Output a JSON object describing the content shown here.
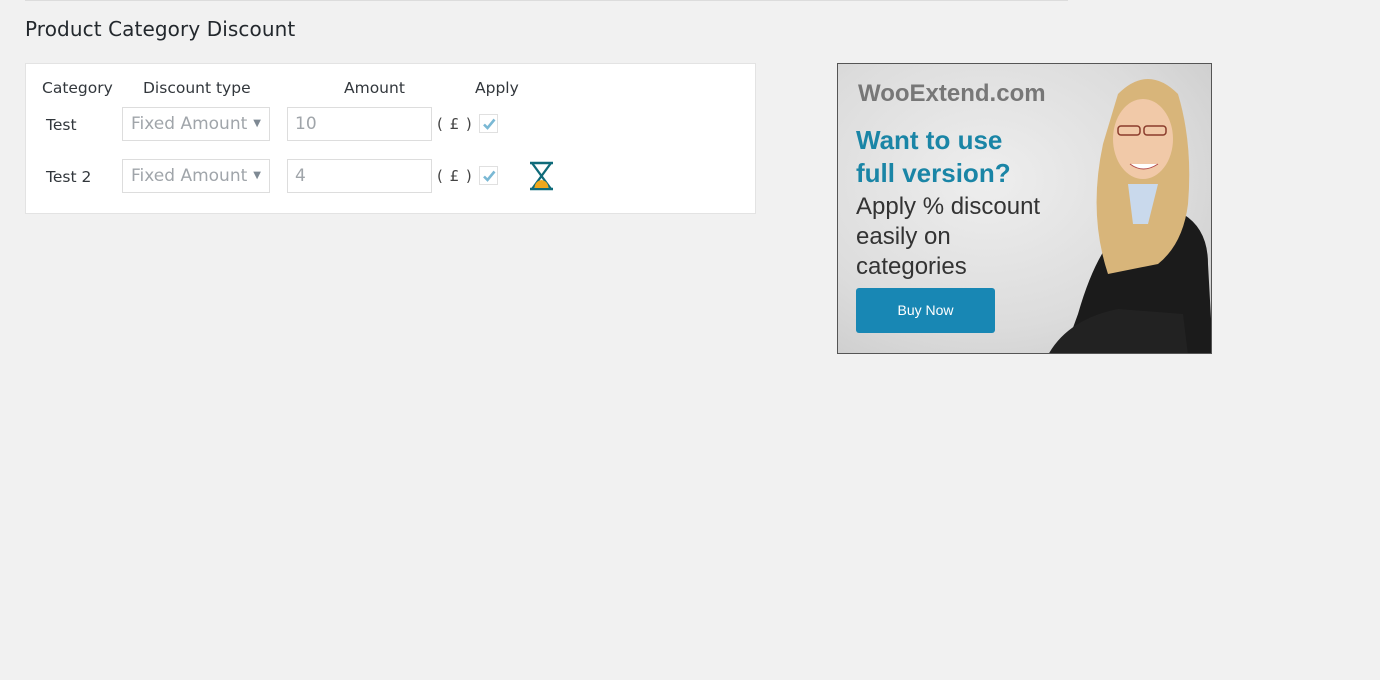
{
  "page": {
    "title": "Product Category Discount"
  },
  "table": {
    "headers": {
      "category": "Category",
      "discount_type": "Discount type",
      "amount": "Amount",
      "apply": "Apply"
    },
    "rows": [
      {
        "category": "Test",
        "discount_type": "Fixed Amount",
        "amount": "10",
        "currency": "( £ )",
        "apply": true,
        "loading": false
      },
      {
        "category": "Test 2",
        "discount_type": "Fixed Amount",
        "amount": "4",
        "currency": "( £ )",
        "apply": true,
        "loading": true
      }
    ],
    "select_arrow": "▼",
    "icons": {
      "check": "checkmark-icon",
      "loading": "hourglass-icon"
    }
  },
  "ad": {
    "site": "WooExtend.com",
    "headline_line1": "Want to use",
    "headline_line2": "full version?",
    "body_line1": "Apply % discount",
    "body_line2": "easily on",
    "body_line3": "categories",
    "button_label": "Buy Now",
    "colors": {
      "headline": "#1a85a6",
      "button": "#1887b4"
    }
  },
  "colors": {
    "background": "#f1f1f1",
    "check": "#7ab8d4",
    "hourglass_frame": "#0f6b7a",
    "hourglass_sand": "#f0a81c"
  }
}
